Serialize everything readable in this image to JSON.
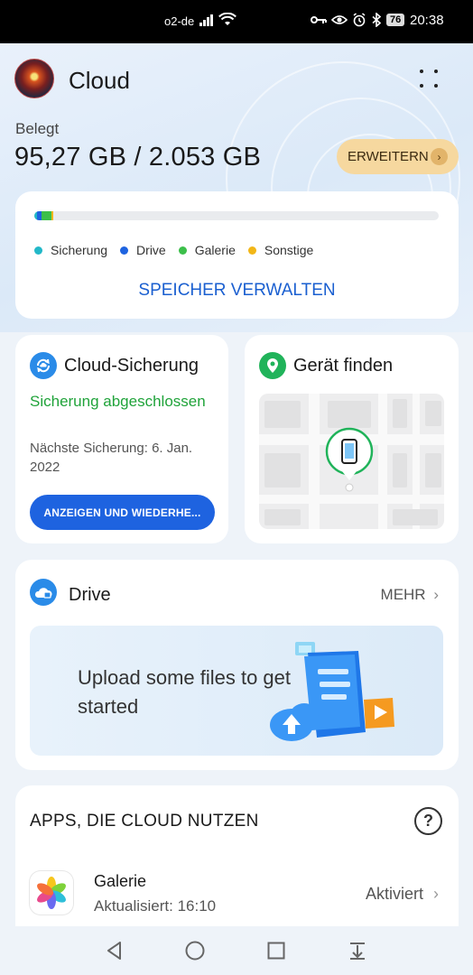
{
  "status_bar": {
    "carrier": "o2-de",
    "battery": "76",
    "time": "20:38"
  },
  "header": {
    "title": "Cloud"
  },
  "storage": {
    "used_label": "Belegt",
    "used_value": "95,27 GB / 2.053 GB",
    "upgrade_label": "ERWEITERN",
    "segments": [
      {
        "name": "Sicherung",
        "fraction": 0.006,
        "color": "#22b8c8"
      },
      {
        "name": "Drive",
        "fraction": 0.012,
        "color": "#1e63e0"
      },
      {
        "name": "Galerie",
        "fraction": 0.025,
        "color": "#3cbf4a"
      },
      {
        "name": "Sonstige",
        "fraction": 0.004,
        "color": "#f2b617"
      }
    ],
    "legend": [
      "Sicherung",
      "Drive",
      "Galerie",
      "Sonstige"
    ],
    "manage_label": "SPEICHER VERWALTEN"
  },
  "backup": {
    "title": "Cloud-Sicherung",
    "status": "Sicherung abgeschlossen",
    "next": "Nächste Sicherung: 6. Jan. 2022",
    "button": "ANZEIGEN UND WIEDERHE..."
  },
  "find_device": {
    "title": "Gerät finden"
  },
  "drive": {
    "title": "Drive",
    "more_label": "MEHR",
    "banner_text": "Upload some files to get started"
  },
  "apps": {
    "title": "APPS, DIE CLOUD NUTZEN",
    "help": "?",
    "items": [
      {
        "name": "Galerie",
        "subtitle": "Aktualisiert: 16:10",
        "status": "Aktiviert"
      }
    ]
  }
}
